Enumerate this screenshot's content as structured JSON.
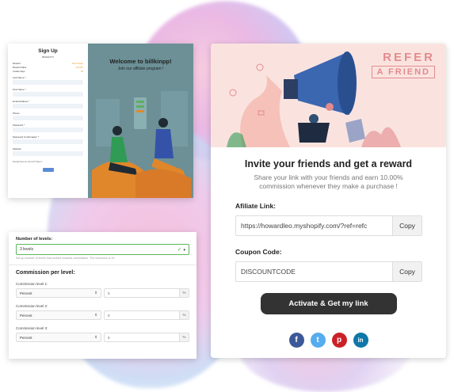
{
  "signup": {
    "title": "Sign Up",
    "subtitle": "BENEFITS",
    "rows": [
      {
        "label": "Reward",
        "tag": "Percentage"
      },
      {
        "label": "Reward Value",
        "tag": "10.00%"
      },
      {
        "label": "Cookie days",
        "tag": "30"
      }
    ],
    "fields": [
      "Last Name *",
      "First Name *",
      "Email Address *",
      "Phone",
      "Password *",
      "Password Confirmation *",
      "Website"
    ],
    "note": "Already have an account? Sign in",
    "welcome": "Welcome to billkinpp!",
    "join": "Join our affiliate program !"
  },
  "levels": {
    "number_label": "Number of levels:",
    "number_value": "3 levels",
    "help": "Set up number of levels that receive rewards commission. The maximum is 10.",
    "heading": "Commission per level:",
    "rows": [
      {
        "label": "Commission level 1:",
        "type": "Percent",
        "value": "0",
        "unit": "%"
      },
      {
        "label": "Commission level 2:",
        "type": "Percent",
        "value": "0",
        "unit": "%"
      },
      {
        "label": "Commission level 3:",
        "type": "Percent",
        "value": "0",
        "unit": "%"
      }
    ]
  },
  "refer": {
    "banner_refer": "REFER",
    "banner_friend": "A FRIEND",
    "heading": "Invite your friends and get a reward",
    "description": "Share your link with your friends and earn 10.00% commission whenever they make a purchase !",
    "affiliate_label": "Afiliate Link:",
    "affiliate_value": "https://howardleo.myshopify.com/?ref=refc",
    "coupon_label": "Coupon Code:",
    "coupon_value": "DISCOUNTCODE",
    "copy_label": "Copy",
    "cta": "Activate & Get my link",
    "social": [
      {
        "icon": "facebook-icon",
        "glyph": "f",
        "color": "#3b5998"
      },
      {
        "icon": "twitter-icon",
        "glyph": "t",
        "color": "#55acee"
      },
      {
        "icon": "pinterest-icon",
        "glyph": "p",
        "color": "#cb2027"
      },
      {
        "icon": "linkedin-icon",
        "glyph": "in",
        "color": "#0e76a8"
      }
    ]
  }
}
